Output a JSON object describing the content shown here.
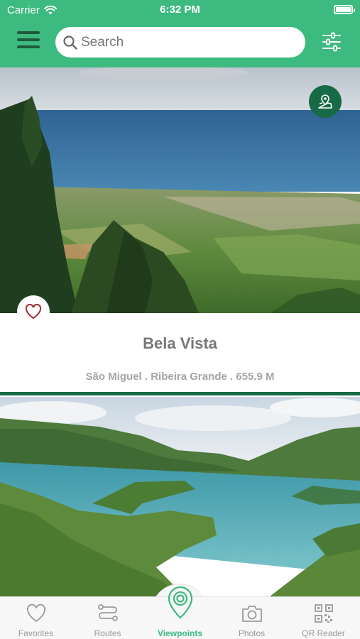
{
  "status_bar": {
    "carrier": "Carrier",
    "time": "6:32 PM"
  },
  "header": {
    "search_placeholder": "Search"
  },
  "cards": [
    {
      "title": "Bela Vista",
      "meta": "São Miguel . Ribeira Grande . 655.9 M"
    }
  ],
  "tabs": [
    {
      "label": "Favorites",
      "icon": "heart-icon"
    },
    {
      "label": "Routes",
      "icon": "route-icon"
    },
    {
      "label": "Viewpoints",
      "icon": "map-pin-icon"
    },
    {
      "label": "Photos",
      "icon": "camera-icon"
    },
    {
      "label": "QR Reader",
      "icon": "qr-code-icon"
    }
  ],
  "active_tab": "Viewpoints",
  "colors": {
    "primary": "#3dba7f",
    "dark": "#176a45"
  }
}
